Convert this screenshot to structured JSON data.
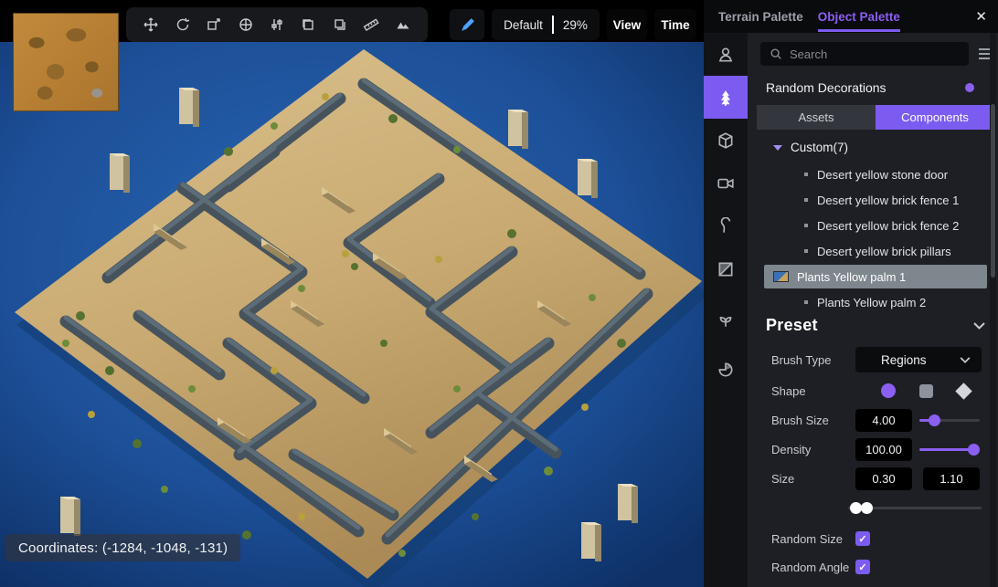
{
  "accent": "#7c5cf0",
  "viewport": {
    "mode_label": "Default",
    "zoom_value": "29%",
    "view_button": "View",
    "time_button": "Time",
    "coordinates": "Coordinates:  (-1284, -1048, -131)",
    "toolbar_icons": [
      "move",
      "rotate",
      "stamp",
      "orbit",
      "sliders",
      "copy",
      "duplicate",
      "ruler",
      "terrain-paint"
    ]
  },
  "panel": {
    "header": {
      "terrain_tab": "Terrain Palette",
      "object_tab": "Object Palette",
      "close_glyph": "✕"
    },
    "search": {
      "placeholder": "Search"
    },
    "section_label": "Random Decorations",
    "tabs": {
      "assets": "Assets",
      "components": "Components"
    },
    "tree": {
      "group_label": "Custom(7)",
      "items": [
        "Desert yellow stone door",
        "Desert yellow brick fence 1",
        "Desert yellow brick fence 2",
        "Desert yellow brick pillars",
        "Plants Yellow palm 1",
        "Plants Yellow palm 2"
      ],
      "selected_index": 4
    },
    "preset": {
      "title": "Preset",
      "brush_type_label": "Brush Type",
      "brush_type_value": "Regions",
      "shape_label": "Shape",
      "brush_size_label": "Brush Size",
      "brush_size_value": "4.00",
      "density_label": "Density",
      "density_value": "100.00",
      "size_label": "Size",
      "size_min_value": "0.30",
      "size_max_value": "1.10",
      "random_size_label": "Random Size",
      "random_angle_label": "Random Angle"
    }
  }
}
